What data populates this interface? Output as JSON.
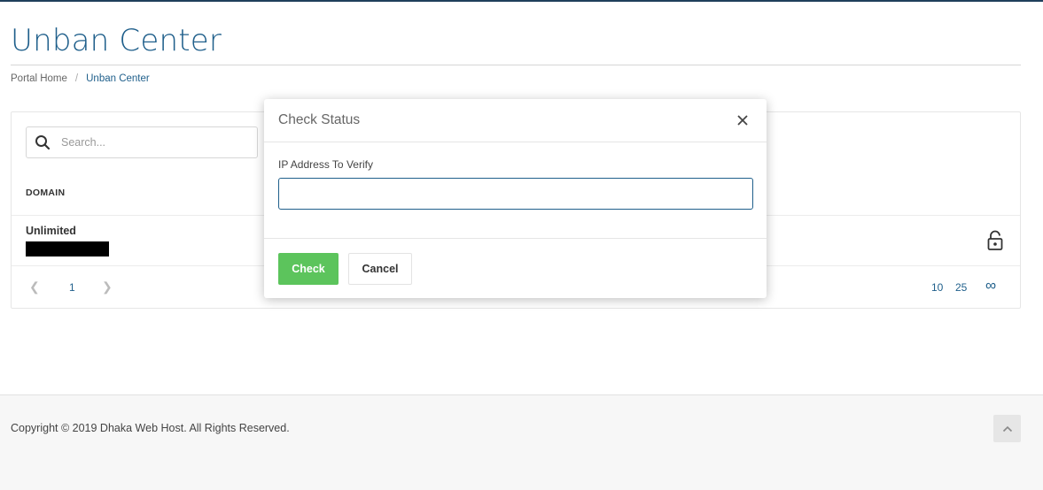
{
  "page": {
    "title": "Unban Center",
    "breadcrumb": [
      "Portal Home",
      "Unban Center"
    ],
    "breadcrumb_separator": "/"
  },
  "table": {
    "search_placeholder": "Search...",
    "column_header": "DOMAIN",
    "rows": [
      {
        "name": "Unlimited",
        "detail_redacted": true,
        "action_icon": "unlock-icon"
      }
    ],
    "pagination": {
      "prev_icon": "chevron-left-icon",
      "current_page": "1",
      "next_icon": "chevron-right-icon",
      "page_sizes": [
        "10",
        "25",
        "∞"
      ]
    }
  },
  "modal": {
    "title": "Check Status",
    "close_icon": "close-icon",
    "field_label": "IP Address To Verify",
    "field_value": "",
    "check_label": "Check",
    "cancel_label": "Cancel"
  },
  "footer": {
    "copyright": "Copyright © 2019 Dhaka Web Host. All Rights Reserved.",
    "back_to_top_icon": "chevron-up-icon"
  },
  "colors": {
    "accent": "#1f5f8b",
    "success": "#5cc45c",
    "footer_bg": "#f7f7f7",
    "top_bar": "#1f3f5b"
  }
}
